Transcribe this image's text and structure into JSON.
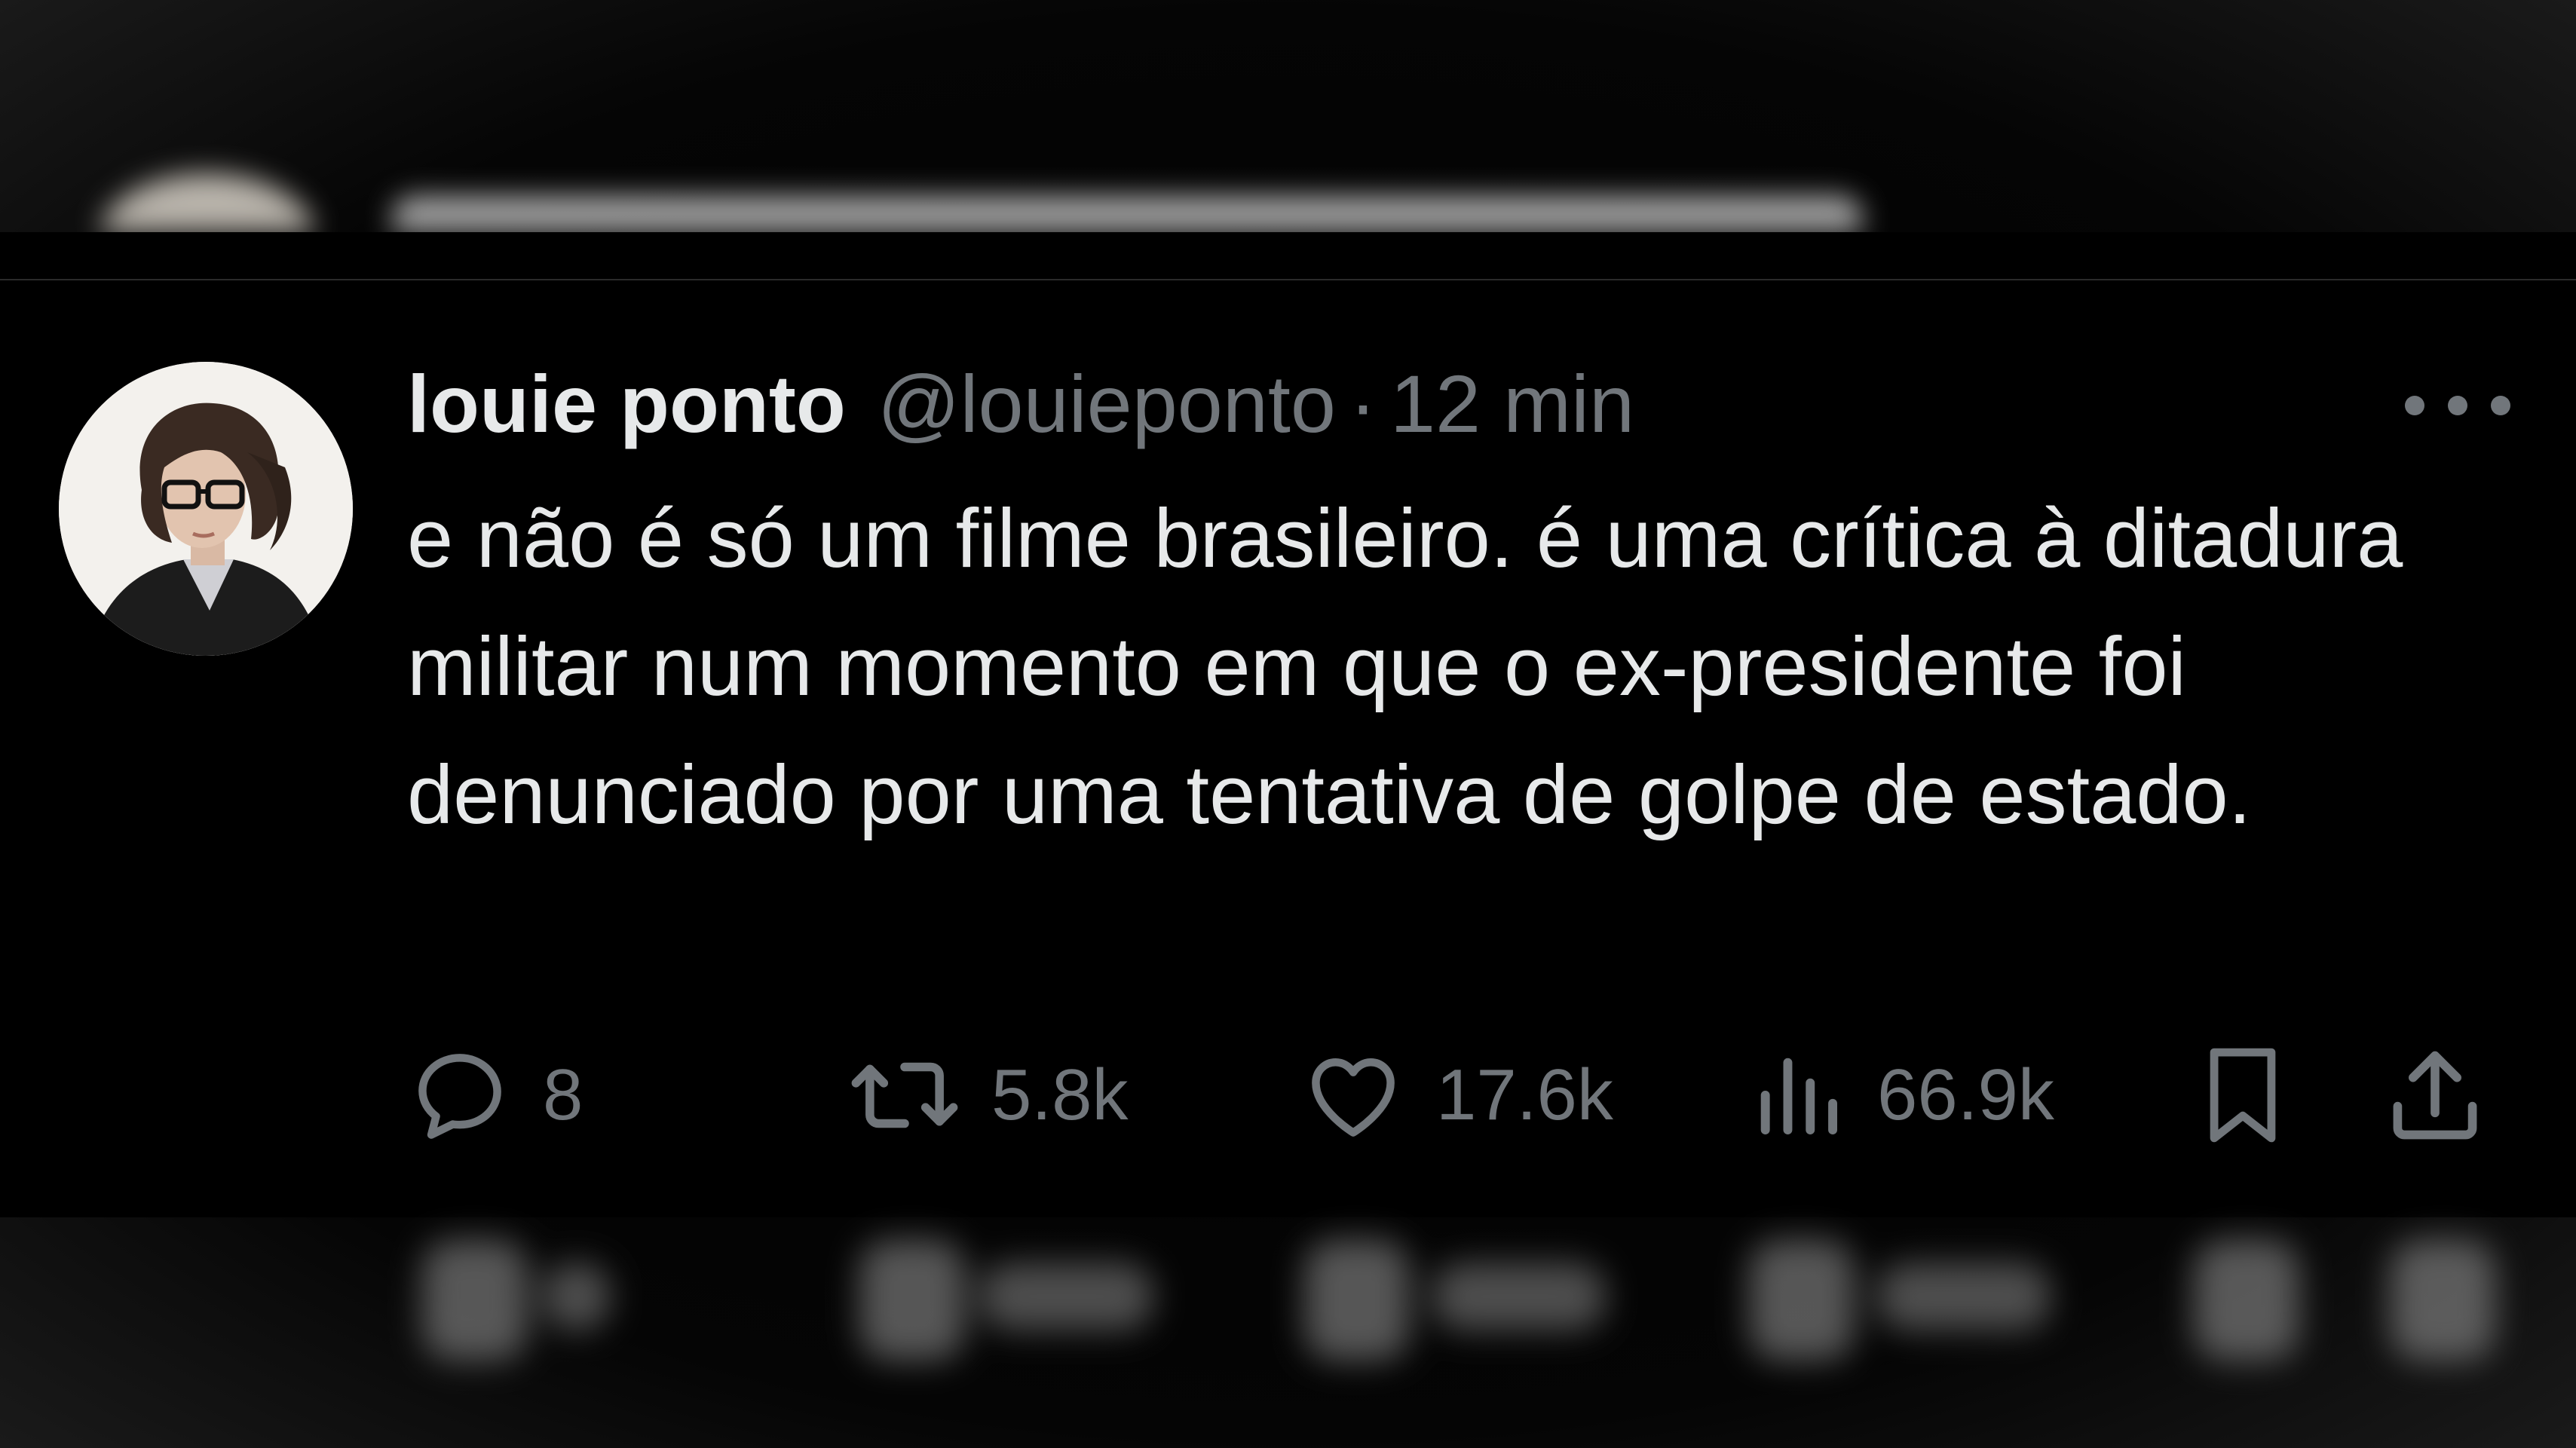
{
  "tweet": {
    "display_name": "louie ponto",
    "handle": "@louieponto",
    "separator": "·",
    "time": "12 min",
    "text": "e não é só um filme brasileiro. é uma crítica à ditadura militar num momento em que o ex-presidente foi denunciado por uma tentativa de golpe de estado."
  },
  "actions": {
    "replies": "8",
    "reposts": "5.8k",
    "likes": "17.6k",
    "views": "66.9k"
  },
  "icons": {
    "reply": "reply-icon",
    "repost": "repost-icon",
    "like": "heart-icon",
    "views": "views-chart-icon",
    "bookmark": "bookmark-icon",
    "share": "share-icon",
    "more": "more-icon"
  },
  "colors": {
    "background": "#000000",
    "text": "#e7e9ea",
    "muted": "#71767b"
  }
}
